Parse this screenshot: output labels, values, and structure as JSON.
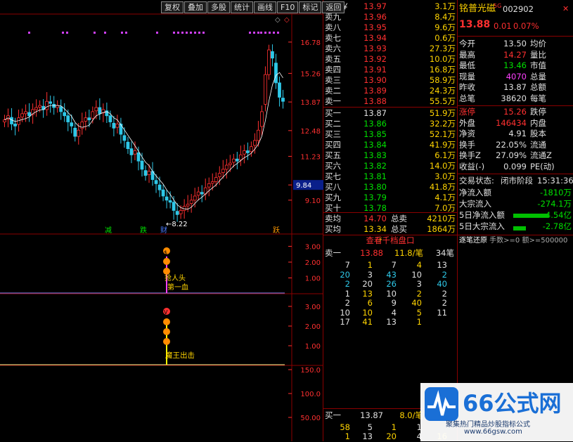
{
  "toolbar": [
    {
      "label": "复权",
      "name": "fuquan"
    },
    {
      "label": "叠加",
      "name": "overlay"
    },
    {
      "label": "多股",
      "name": "multi-stock"
    },
    {
      "label": "统计",
      "name": "stats"
    },
    {
      "label": "画线",
      "name": "draw-line"
    },
    {
      "label": "F10",
      "name": "f10"
    },
    {
      "label": "标记",
      "name": "mark"
    },
    {
      "label": "返回",
      "name": "back"
    }
  ],
  "main_chart": {
    "price_ticks": [
      "16.78",
      "15.26",
      "13.87",
      "12.48",
      "11.23",
      "9.84",
      "9.10"
    ],
    "badge": "9.84",
    "min_label": "←8.22",
    "markers": [
      "减",
      "跌",
      "财",
      "跃"
    ],
    "ylim": [
      7.9,
      17.8
    ]
  },
  "ind1": {
    "ticks": [
      "3.00",
      "2.00",
      "1.00"
    ],
    "top_icon": "$",
    "labels": [
      "抢人头",
      "第一血"
    ]
  },
  "ind2": {
    "ticks": [
      "3.00",
      "2.00",
      "1.00"
    ],
    "top_icon": "V",
    "label": "魔王出击"
  },
  "ind3": {
    "ticks": [
      "150.0",
      "100.0",
      "50.00"
    ]
  },
  "orderbook": {
    "asks": [
      {
        "label": "卖十￥",
        "price": "13.97",
        "vol": "3.1万"
      },
      {
        "label": "卖九",
        "price": "13.96",
        "vol": "8.4万"
      },
      {
        "label": "卖八",
        "price": "13.95",
        "vol": "9.6万"
      },
      {
        "label": "卖七",
        "price": "13.94",
        "vol": "0.6万"
      },
      {
        "label": "卖六",
        "price": "13.93",
        "vol": "27.3万"
      },
      {
        "label": "卖五",
        "price": "13.92",
        "vol": "10.0万"
      },
      {
        "label": "卖四",
        "price": "13.91",
        "vol": "16.8万"
      },
      {
        "label": "卖三",
        "price": "13.90",
        "vol": "58.9万"
      },
      {
        "label": "卖二",
        "price": "13.89",
        "vol": "24.3万"
      },
      {
        "label": "卖一",
        "price": "13.88",
        "vol": "55.5万"
      }
    ],
    "bids": [
      {
        "label": "买一",
        "price": "13.87",
        "vol": "51.9万"
      },
      {
        "label": "买二",
        "price": "13.86",
        "vol": "32.2万"
      },
      {
        "label": "买三",
        "price": "13.85",
        "vol": "52.1万"
      },
      {
        "label": "买四",
        "price": "13.84",
        "vol": "41.9万"
      },
      {
        "label": "买五",
        "price": "13.83",
        "vol": "6.1万"
      },
      {
        "label": "买六",
        "price": "13.82",
        "vol": "14.0万"
      },
      {
        "label": "买七",
        "price": "13.81",
        "vol": "3.0万"
      },
      {
        "label": "买八",
        "price": "13.80",
        "vol": "41.8万"
      },
      {
        "label": "买九",
        "price": "13.79",
        "vol": "4.1万"
      },
      {
        "label": "买十",
        "price": "13.78",
        "vol": "7.0万"
      }
    ],
    "avg_ask": {
      "label": "卖均",
      "price": "14.70",
      "tlabel": "总卖",
      "total": "4210万"
    },
    "avg_bid": {
      "label": "买均",
      "price": "13.34",
      "tlabel": "总买",
      "total": "1864万"
    }
  },
  "stock": {
    "name": "铭普光磁",
    "tag": "5G",
    "code": "002902",
    "price": "13.88",
    "change": "0.01",
    "pct": "0.07%",
    "pairs": [
      [
        "今开",
        "13.50",
        "均价",
        ""
      ],
      [
        "最高",
        "14.27",
        "量比",
        ""
      ],
      [
        "最低",
        "13.46",
        "市值",
        ""
      ],
      [
        "现量",
        "4070",
        "总量",
        ""
      ],
      [
        "昨收",
        "13.87",
        "总额",
        ""
      ],
      [
        "总笔",
        "38620",
        "每笔",
        ""
      ]
    ],
    "pairs2": [
      [
        "涨停",
        "15.26",
        "跌停",
        ""
      ],
      [
        "外盘",
        "146434",
        "内盘",
        ""
      ],
      [
        "净资",
        "4.91",
        "股本",
        ""
      ],
      [
        "换手",
        "22.05%",
        "流通",
        ""
      ],
      [
        "换手Z",
        "27.09%",
        "流通Z",
        ""
      ],
      [
        "收益(-)",
        "0.099",
        "PE(动)",
        ""
      ]
    ],
    "status_label": "交易状态:",
    "status_val": "闭市阶段",
    "time": "15:31:36",
    "flows": [
      {
        "label": "净流入额",
        "val": "-1810万"
      },
      {
        "label": "大宗流入",
        "val": "-274.1万"
      },
      {
        "label": "5日净流入额",
        "val": "-4.54亿"
      },
      {
        "label": "5日大宗流入",
        "val": "-2.78亿"
      }
    ]
  },
  "tick": {
    "header": "查看千档盘口",
    "sell1": {
      "label": "卖一",
      "price": "13.88",
      "vol": "11.8/笔",
      "n": "34笔"
    },
    "grid": [
      [
        7,
        1,
        7,
        4,
        13
      ],
      [
        20,
        3,
        43,
        10,
        2
      ],
      [
        2,
        20,
        26,
        3,
        40
      ],
      [
        1,
        13,
        10,
        2,
        2
      ],
      [
        2,
        6,
        9,
        40,
        2
      ],
      [
        10,
        10,
        4,
        5,
        11
      ],
      [
        17,
        41,
        13,
        1,
        ""
      ]
    ],
    "buy1": {
      "label": "买一",
      "price": "13.87",
      "vol": "8.0/笔"
    },
    "buy_grid": [
      [
        58,
        5,
        1,
        1,
        ""
      ],
      [
        1,
        13,
        20,
        4,
        "16"
      ]
    ],
    "bottom_label": "逐笔还原",
    "bottom_hint": "手数>=0 额>=500000"
  },
  "watermark": {
    "logo": "66公式网",
    "slogan": "聚集热门精品炒股指标公式",
    "url": "www.66gsw.com"
  },
  "colors": {
    "up": "#ff3030",
    "down": "#2ec8e8",
    "ma": "#ffffff"
  }
}
